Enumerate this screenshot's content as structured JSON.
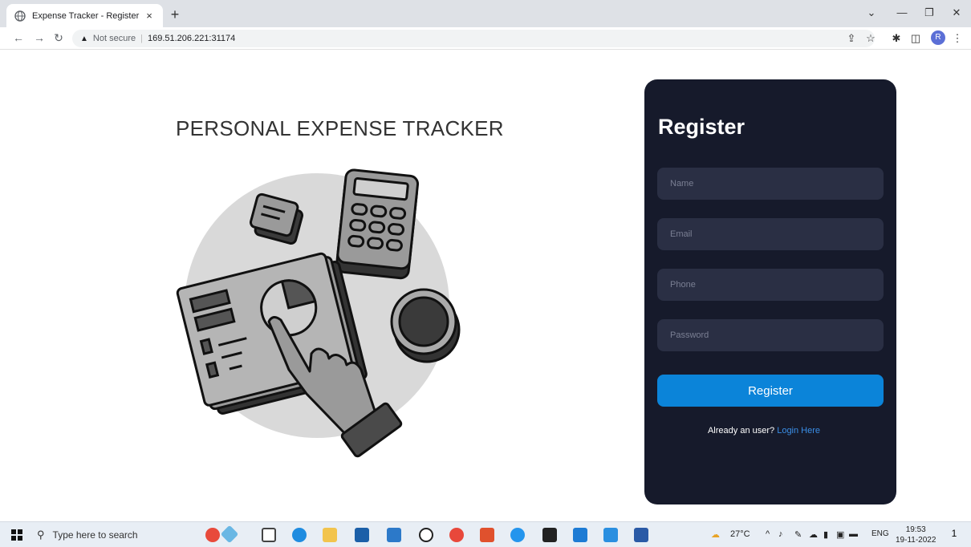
{
  "browser": {
    "tab_title": "Expense Tracker - Register",
    "tab_close": "×",
    "new_tab": "+",
    "security_label": "Not secure",
    "url": "169.51.206.221:31174",
    "avatar_letter": "R"
  },
  "page": {
    "heading": "PERSONAL EXPENSE TRACKER"
  },
  "form": {
    "title": "Register",
    "name_placeholder": "Name",
    "email_placeholder": "Email",
    "phone_placeholder": "Phone",
    "password_placeholder": "Password",
    "submit_label": "Register",
    "already_text": "Already an user?",
    "login_link": "Login Here"
  },
  "taskbar": {
    "search_placeholder": "Type here to search",
    "temperature": "27°C",
    "language": "ENG",
    "time": "19:53",
    "date": "19-11-2022",
    "notification_count": "1"
  },
  "colors": {
    "card_bg": "#161a2b",
    "field_bg": "#2a2f44",
    "button": "#0b84d9",
    "link": "#3a8ee6"
  }
}
